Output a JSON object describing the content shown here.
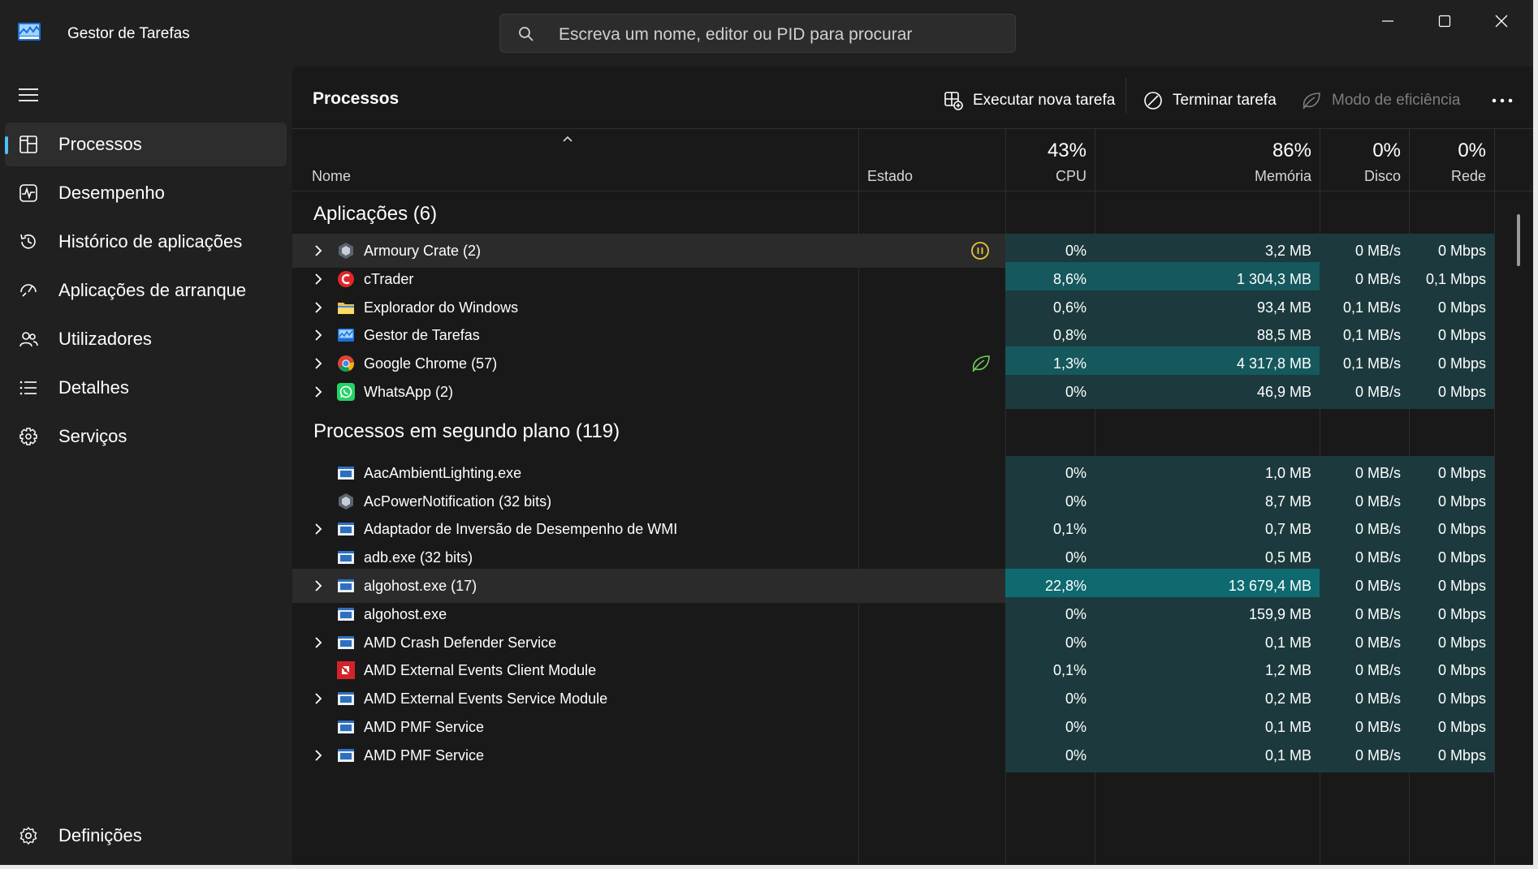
{
  "window": {
    "title": "Gestor de Tarefas"
  },
  "search": {
    "placeholder": "Escreva um nome, editor ou PID para procurar"
  },
  "sidebar": {
    "items": [
      {
        "label": "Processos",
        "icon": "processes-icon",
        "active": true
      },
      {
        "label": "Desempenho",
        "icon": "performance-icon"
      },
      {
        "label": "Histórico de aplicações",
        "icon": "history-icon"
      },
      {
        "label": "Aplicações de arranque",
        "icon": "startup-icon"
      },
      {
        "label": "Utilizadores",
        "icon": "users-icon"
      },
      {
        "label": "Detalhes",
        "icon": "details-icon"
      },
      {
        "label": "Serviços",
        "icon": "services-icon"
      }
    ],
    "settings_label": "Definições"
  },
  "main": {
    "title": "Processos",
    "toolbar": {
      "run_task": "Executar nova tarefa",
      "end_task": "Terminar tarefa",
      "efficiency_mode": "Modo de eficiência"
    }
  },
  "columns": {
    "name": "Nome",
    "status": "Estado",
    "cpu": {
      "pct": "43%",
      "label": "CPU"
    },
    "memory": {
      "pct": "86%",
      "label": "Memória"
    },
    "disk": {
      "pct": "0%",
      "label": "Disco"
    },
    "network": {
      "pct": "0%",
      "label": "Rede"
    }
  },
  "colors": {
    "heat_low": "#1c3a3d",
    "heat_mid": "#15585d",
    "heat_high": "#0f6a70",
    "accent": "#4cc2ff",
    "suspended": "#e8c43a",
    "efficiency": "#6ccf5a"
  },
  "groups": [
    {
      "label": "Aplicações (6)",
      "rows": [
        {
          "name": "Armoury Crate (2)",
          "icon": "armoury-icon",
          "expand": true,
          "status": "suspended-icon",
          "cpu": "0%",
          "mem": "3,2 MB",
          "disk": "0 MB/s",
          "net": "0 Mbps",
          "highlight": true
        },
        {
          "name": "cTrader",
          "icon": "ctrader-icon",
          "expand": true,
          "cpu": "8,6%",
          "mem": "1 304,3 MB",
          "disk": "0 MB/s",
          "net": "0,1 Mbps"
        },
        {
          "name": "Explorador do Windows",
          "icon": "folder-icon",
          "expand": true,
          "cpu": "0,6%",
          "mem": "93,4 MB",
          "disk": "0,1 MB/s",
          "net": "0 Mbps"
        },
        {
          "name": "Gestor de Tarefas",
          "icon": "task-manager-icon",
          "expand": true,
          "cpu": "0,8%",
          "mem": "88,5 MB",
          "disk": "0,1 MB/s",
          "net": "0 Mbps"
        },
        {
          "name": "Google Chrome (57)",
          "icon": "chrome-icon",
          "expand": true,
          "status": "efficiency-leaf-icon",
          "cpu": "1,3%",
          "mem": "4 317,8 MB",
          "disk": "0,1 MB/s",
          "net": "0 Mbps"
        },
        {
          "name": "WhatsApp (2)",
          "icon": "whatsapp-icon",
          "expand": true,
          "cpu": "0%",
          "mem": "46,9 MB",
          "disk": "0 MB/s",
          "net": "0 Mbps"
        }
      ]
    },
    {
      "label": "Processos em segundo plano (119)",
      "rows": [
        {
          "name": "AacAmbientLighting.exe",
          "icon": "window-app-icon",
          "expand": false,
          "cpu": "0%",
          "mem": "1,0 MB",
          "disk": "0 MB/s",
          "net": "0 Mbps"
        },
        {
          "name": "AcPowerNotification (32 bits)",
          "icon": "armoury-icon",
          "expand": false,
          "cpu": "0%",
          "mem": "8,7 MB",
          "disk": "0 MB/s",
          "net": "0 Mbps"
        },
        {
          "name": "Adaptador de Inversão de Desempenho de WMI",
          "icon": "window-app-icon",
          "expand": true,
          "cpu": "0,1%",
          "mem": "0,7 MB",
          "disk": "0 MB/s",
          "net": "0 Mbps"
        },
        {
          "name": "adb.exe (32 bits)",
          "icon": "window-app-icon",
          "expand": false,
          "cpu": "0%",
          "mem": "0,5 MB",
          "disk": "0 MB/s",
          "net": "0 Mbps"
        },
        {
          "name": "algohost.exe (17)",
          "icon": "window-app-icon",
          "expand": true,
          "cpu": "22,8%",
          "mem": "13 679,4 MB",
          "disk": "0 MB/s",
          "net": "0 Mbps",
          "highlight": true
        },
        {
          "name": "algohost.exe",
          "icon": "window-app-icon",
          "expand": false,
          "cpu": "0%",
          "mem": "159,9 MB",
          "disk": "0 MB/s",
          "net": "0 Mbps"
        },
        {
          "name": "AMD Crash Defender Service",
          "icon": "window-app-icon",
          "expand": true,
          "cpu": "0%",
          "mem": "0,1 MB",
          "disk": "0 MB/s",
          "net": "0 Mbps"
        },
        {
          "name": "AMD External Events Client Module",
          "icon": "amd-icon",
          "expand": false,
          "cpu": "0,1%",
          "mem": "1,2 MB",
          "disk": "0 MB/s",
          "net": "0 Mbps"
        },
        {
          "name": "AMD External Events Service Module",
          "icon": "window-app-icon",
          "expand": true,
          "cpu": "0%",
          "mem": "0,2 MB",
          "disk": "0 MB/s",
          "net": "0 Mbps"
        },
        {
          "name": "AMD PMF Service",
          "icon": "window-app-icon",
          "expand": false,
          "cpu": "0%",
          "mem": "0,1 MB",
          "disk": "0 MB/s",
          "net": "0 Mbps"
        },
        {
          "name": "AMD PMF Service",
          "icon": "window-app-icon",
          "expand": true,
          "cpu": "0%",
          "mem": "0,1 MB",
          "disk": "0 MB/s",
          "net": "0 Mbps"
        }
      ]
    }
  ]
}
